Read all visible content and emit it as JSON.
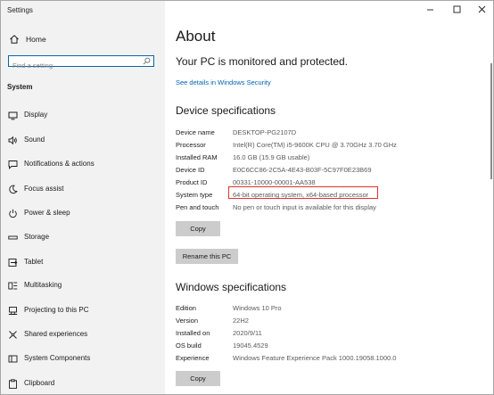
{
  "window": {
    "title": "Settings"
  },
  "sidebar": {
    "home_label": "Home",
    "search_placeholder": "Find a setting",
    "section": "System",
    "items": [
      {
        "label": "Display",
        "icon": "display-icon"
      },
      {
        "label": "Sound",
        "icon": "sound-icon"
      },
      {
        "label": "Notifications & actions",
        "icon": "notifications-icon"
      },
      {
        "label": "Focus assist",
        "icon": "focus-assist-icon"
      },
      {
        "label": "Power & sleep",
        "icon": "power-icon"
      },
      {
        "label": "Storage",
        "icon": "storage-icon"
      },
      {
        "label": "Tablet",
        "icon": "tablet-icon"
      },
      {
        "label": "Multitasking",
        "icon": "multitasking-icon"
      },
      {
        "label": "Projecting to this PC",
        "icon": "projecting-icon"
      },
      {
        "label": "Shared experiences",
        "icon": "shared-experiences-icon"
      },
      {
        "label": "System Components",
        "icon": "system-components-icon"
      },
      {
        "label": "Clipboard",
        "icon": "clipboard-icon"
      }
    ]
  },
  "main": {
    "title": "About",
    "protected_text": "Your PC is monitored and protected.",
    "security_link": "See details in Windows Security",
    "device_specs": {
      "heading": "Device specifications",
      "rows": [
        {
          "label": "Device name",
          "value": "DESKTOP-PG2107D"
        },
        {
          "label": "Processor",
          "value": "Intel(R) Core(TM) i5-9600K CPU @ 3.70GHz   3.70 GHz"
        },
        {
          "label": "Installed RAM",
          "value": "16.0 GB (15.9 GB usable)"
        },
        {
          "label": "Device ID",
          "value": "E0C6CC86-2C5A-4E43-B03F-5C97F0E23B69"
        },
        {
          "label": "Product ID",
          "value": "00331-10000-00001-AA538"
        },
        {
          "label": "System type",
          "value": "64-bit operating system, x64-based processor"
        },
        {
          "label": "Pen and touch",
          "value": "No pen or touch input is available for this display"
        }
      ],
      "copy_label": "Copy",
      "rename_label": "Rename this PC"
    },
    "windows_specs": {
      "heading": "Windows specifications",
      "rows": [
        {
          "label": "Edition",
          "value": "Windows 10 Pro"
        },
        {
          "label": "Version",
          "value": "22H2"
        },
        {
          "label": "Installed on",
          "value": "2020/9/11"
        },
        {
          "label": "OS build",
          "value": "19045.4529"
        },
        {
          "label": "Experience",
          "value": "Windows Feature Experience Pack 1000.19058.1000.0"
        }
      ],
      "copy_label": "Copy"
    }
  },
  "colors": {
    "accent": "#0063b1",
    "highlight_box": "#e13131",
    "sidebar_bg": "#f2f2f2",
    "button_bg": "#cccccc"
  }
}
